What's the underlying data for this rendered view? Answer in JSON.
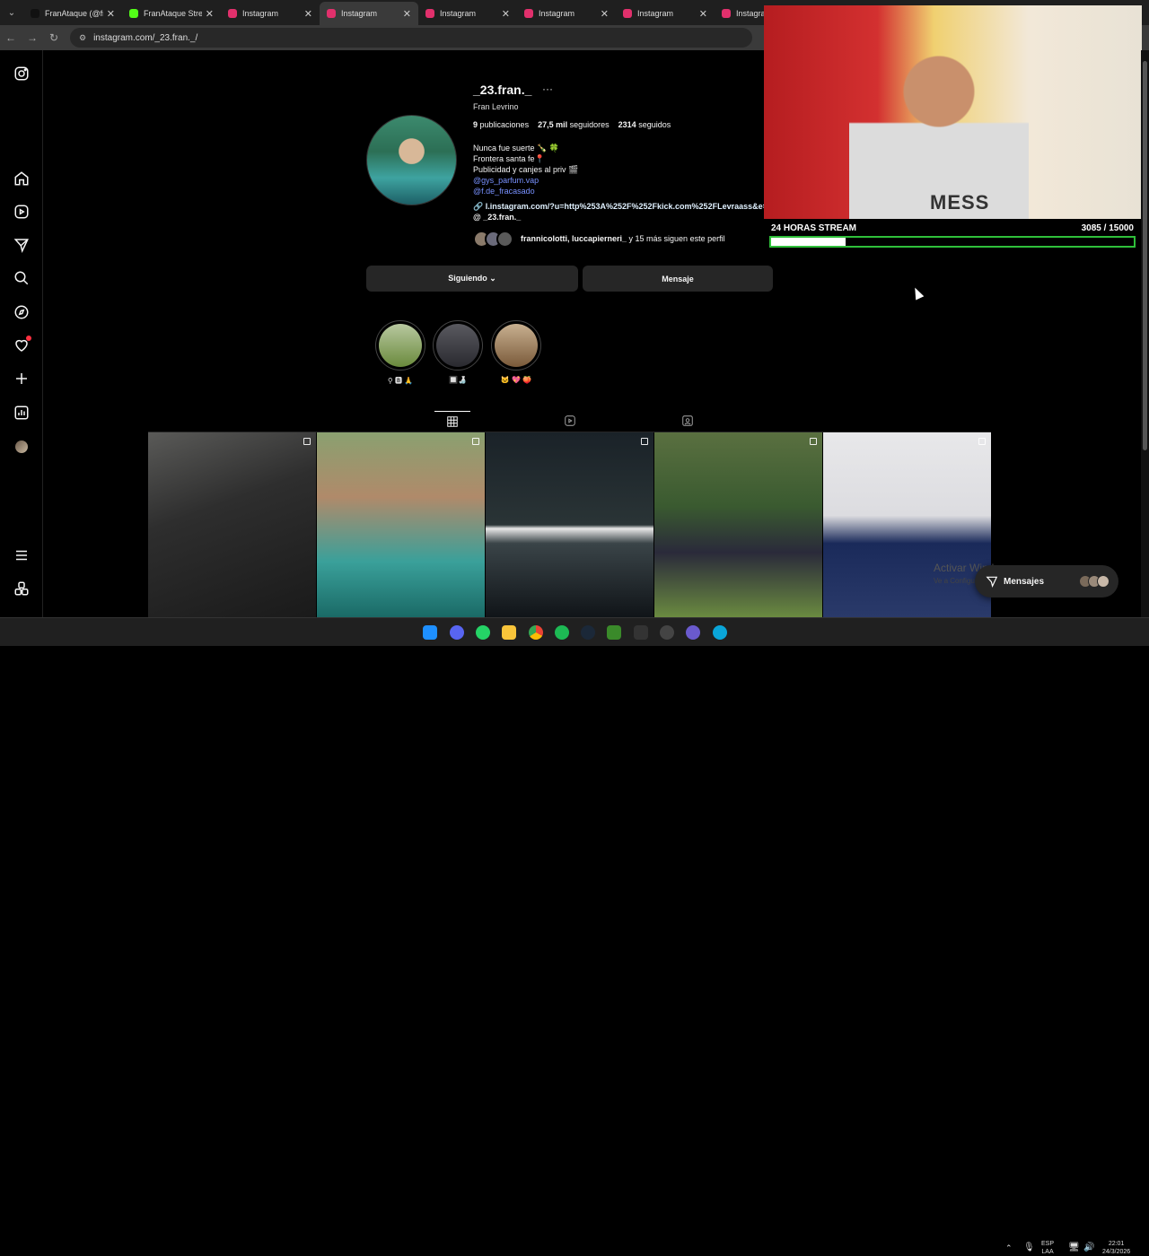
{
  "tabs": [
    {
      "title": "FranAtaque (@fra",
      "fav": "#111",
      "active": false
    },
    {
      "title": "FranAtaque Strea",
      "fav": "#53fc18",
      "active": false
    },
    {
      "title": "Instagram",
      "fav": "#e1306c",
      "active": false
    },
    {
      "title": "Instagram",
      "fav": "#e1306c",
      "active": true
    },
    {
      "title": "Instagram",
      "fav": "#e1306c",
      "active": false
    },
    {
      "title": "Instagram",
      "fav": "#e1306c",
      "active": false
    },
    {
      "title": "Instagram",
      "fav": "#e1306c",
      "active": false
    },
    {
      "title": "Instagra",
      "fav": "#e1306c",
      "active": false
    }
  ],
  "address": {
    "url": "instagram.com/_23.fran._/"
  },
  "profile": {
    "username": "_23.fran._",
    "more": "···",
    "full_name": "Fran Levrino",
    "posts_count": "9",
    "posts_label": "publicaciones",
    "followers_count": "27,5 mil",
    "followers_label": "seguidores",
    "following_count": "2314",
    "following_label": "seguidos",
    "bio_lines": [
      "Nunca fue suerte 🍾 🍀",
      "Frontera santa fe📍",
      "Publicidad y canjes al priv 🎬"
    ],
    "mentions": [
      "@gys_parfum.vap",
      "@f.de_fracasado"
    ],
    "external_link": "l.instagram.com/?u=http%253A%252F%252Fkick.com%252FLevraass&e=",
    "threads_handle": "_23.fran._",
    "followed_by_names": "frannicolotti, luccapierneri_",
    "followed_by_suffix": " y 15 más siguen este perfil"
  },
  "actions": {
    "following": "Siguiendo ⌄",
    "message": "Mensaje"
  },
  "highlights": [
    {
      "label": "⚲ 🅱 🙏",
      "color": "#6a8a3c"
    },
    {
      "label": "🔲🍶",
      "color": "#3a3a40"
    },
    {
      "label": "🐱 💖 🍑",
      "color": "#8a6a4a"
    }
  ],
  "stream": {
    "goal_title": "24 HORAS STREAM",
    "goal_value": "3085  / 15000",
    "goal_fraction": 0.2057,
    "shirt_text": "MESS"
  },
  "windows": {
    "activate_title": "Activar Windows",
    "activate_sub": "Ve a Configuración para activar Windows."
  },
  "messages_pill": {
    "label": "Mensajes"
  },
  "tray": {
    "lang": "ESP",
    "region": "LAA",
    "time": "22:01",
    "date": "24/3/2026"
  },
  "colors": {
    "accent_link": "#7891ff",
    "goal_border": "#2fbf3a",
    "notif": "#ff3040"
  }
}
